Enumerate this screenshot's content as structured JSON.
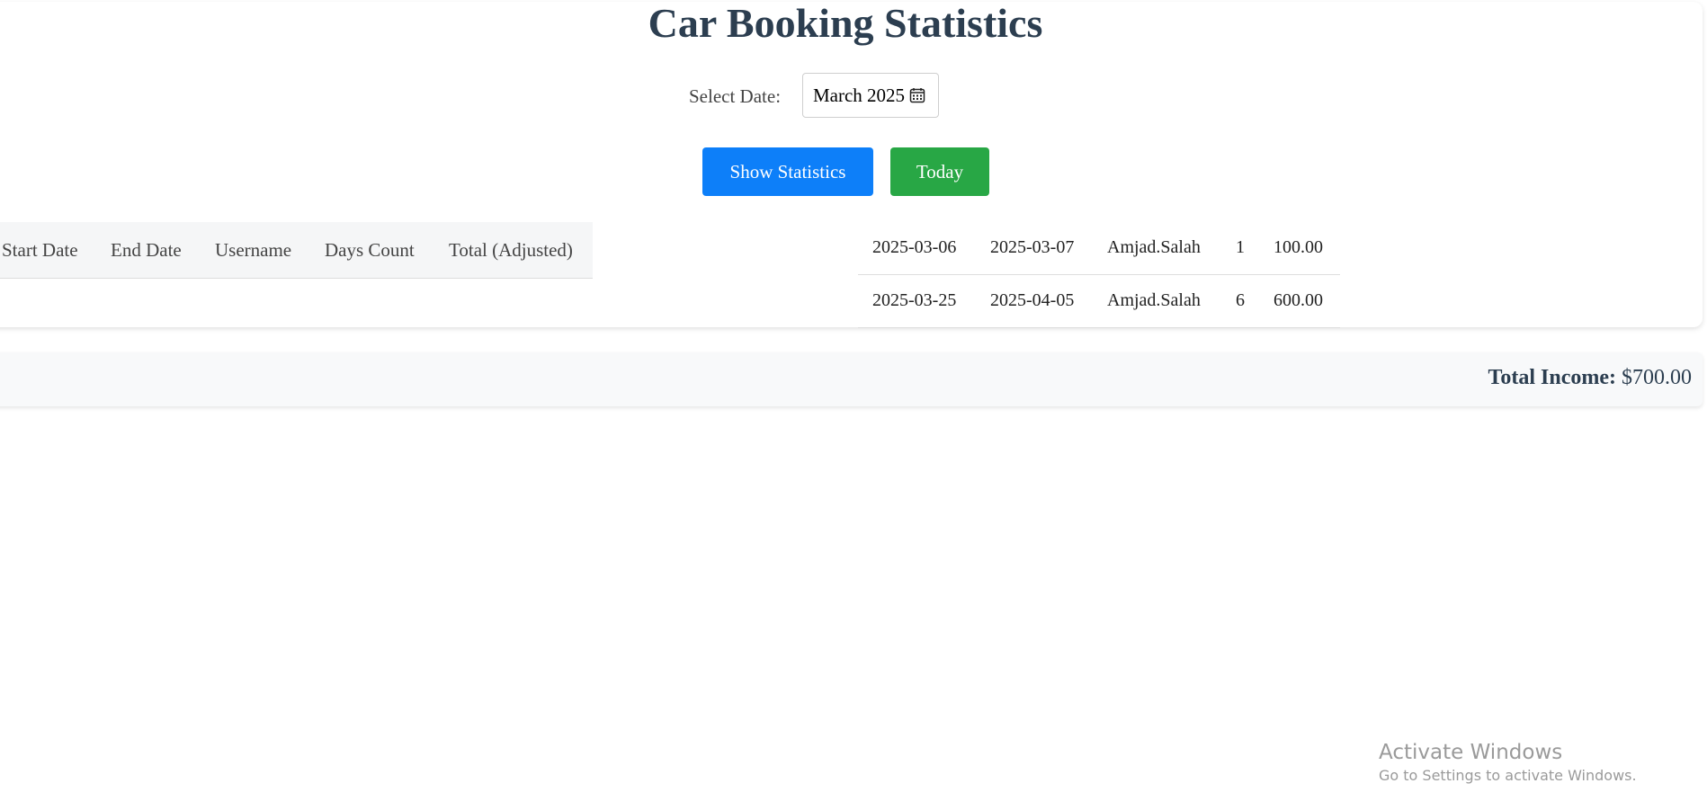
{
  "page": {
    "title": "Car Booking Statistics"
  },
  "date_picker": {
    "label": "Select Date:",
    "value": "March 2025",
    "icon": "calendar-icon"
  },
  "buttons": {
    "show_statistics": "Show Statistics",
    "today": "Today"
  },
  "table": {
    "columns": [
      "Start Date",
      "End Date",
      "Username",
      "Days Count",
      "Total (Adjusted)"
    ],
    "rows": [
      [
        "2025-03-06",
        "2025-03-07",
        "Amjad.Salah",
        "1",
        "100.00"
      ],
      [
        "2025-03-25",
        "2025-04-05",
        "Amjad.Salah",
        "6",
        "600.00"
      ]
    ]
  },
  "summary": {
    "total_income_label": "Total Income:",
    "total_income_value": "$700.00"
  },
  "watermark": {
    "line1": "Activate Windows",
    "line2": "Go to Settings to activate Windows."
  },
  "colors": {
    "title": "#2c3e50",
    "show_statistics_button": "#0d7ff9",
    "today_button": "#28a745",
    "summary_background": "#f8f9fa"
  }
}
